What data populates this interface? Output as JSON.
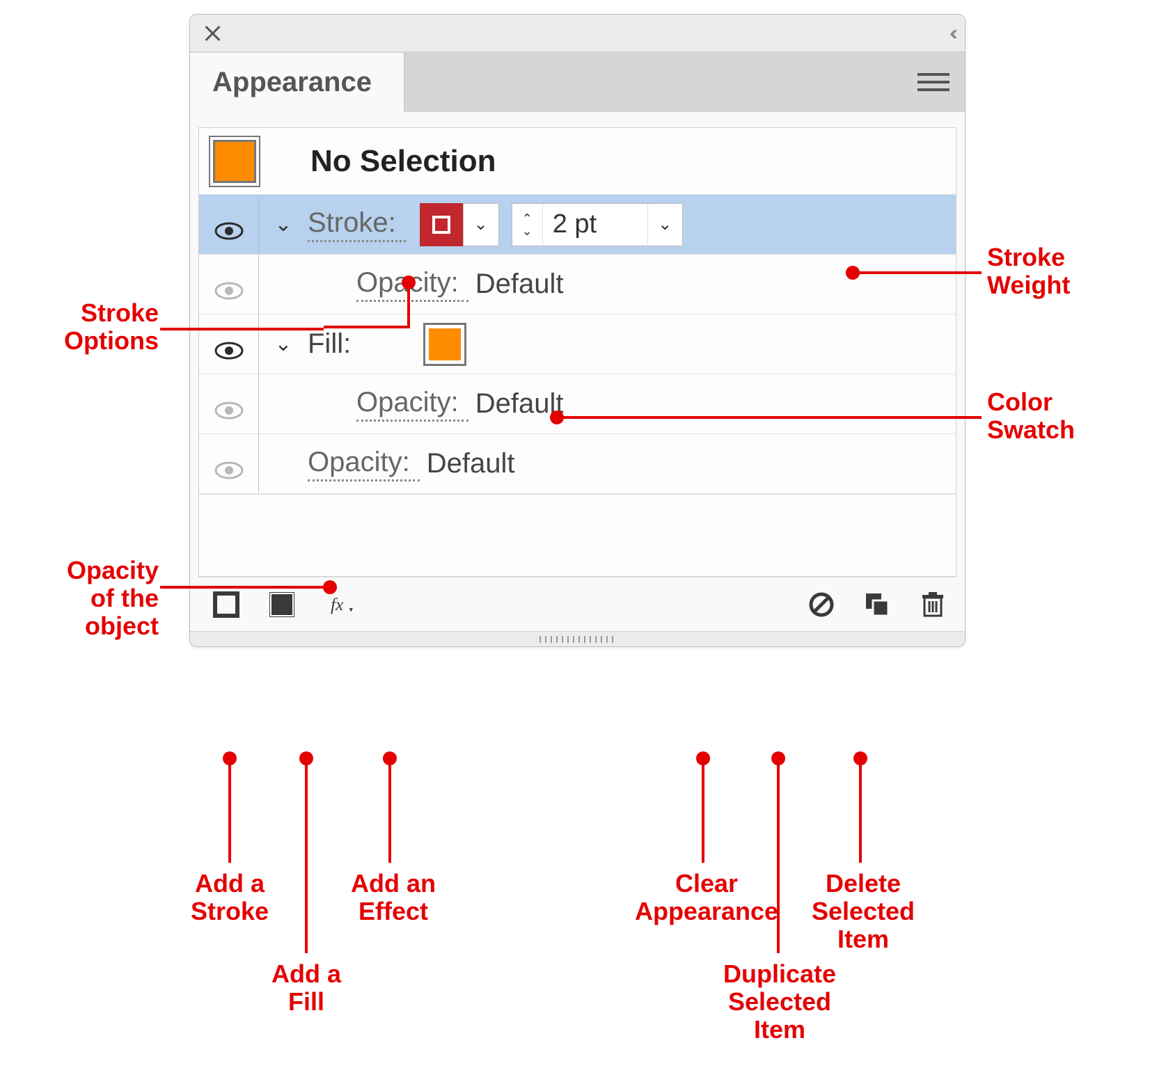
{
  "panel": {
    "tab": "Appearance",
    "selection_title": "No Selection",
    "thumb_fill": "#ff8c00"
  },
  "rows": {
    "stroke": {
      "label": "Stroke:",
      "swatch_color": "#c1272d",
      "weight": "2 pt",
      "opacity_label": "Opacity:",
      "opacity_value": "Default"
    },
    "fill": {
      "label": "Fill:",
      "swatch_color": "#ff8c00",
      "opacity_label": "Opacity:",
      "opacity_value": "Default"
    },
    "object_opacity": {
      "label": "Opacity:",
      "value": "Default"
    }
  },
  "annotations": {
    "stroke_options": "Stroke\nOptions",
    "opacity_object": "Opacity\nof the\nobject",
    "stroke_weight": "Stroke\nWeight",
    "color_swatch": "Color\nSwatch",
    "add_stroke": "Add a\nStroke",
    "add_fill": "Add a\nFill",
    "add_effect": "Add an\nEffect",
    "clear_appearance": "Clear\nAppearance",
    "duplicate": "Duplicate\nSelected\nItem",
    "delete": "Delete\nSelected\nItem"
  }
}
